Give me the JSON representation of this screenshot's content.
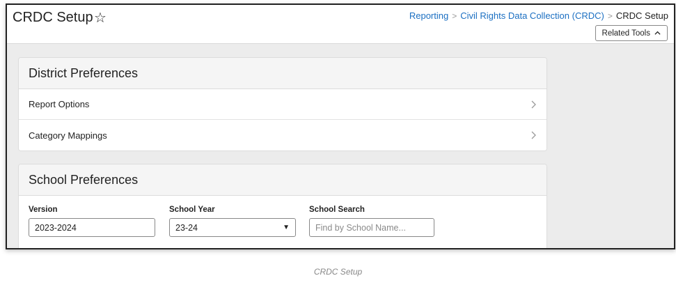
{
  "header": {
    "title": "CRDC Setup",
    "star_glyph": "☆",
    "breadcrumb": {
      "link1": "Reporting",
      "link2": "Civil Rights Data Collection (CRDC)",
      "current": "CRDC Setup",
      "separator": ">"
    },
    "related_tools_label": "Related Tools"
  },
  "district": {
    "title": "District Preferences",
    "rows": [
      "Report Options",
      "Category Mappings"
    ]
  },
  "school": {
    "title": "School Preferences",
    "version": {
      "label": "Version",
      "value": "2023-2024"
    },
    "school_year": {
      "label": "School Year",
      "value": "23-24"
    },
    "school_search": {
      "label": "School Search",
      "placeholder": "Find by School Name..."
    }
  },
  "caption": "CRDC Setup",
  "colors": {
    "link": "#1b6fc2",
    "background": "#ececec"
  }
}
